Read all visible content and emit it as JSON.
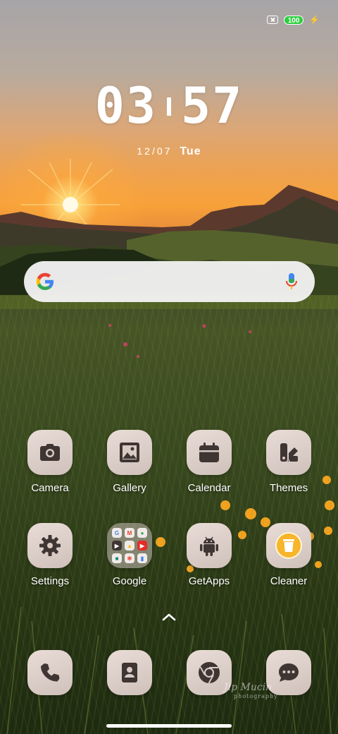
{
  "status_bar": {
    "sim_icon": "no-sim-icon",
    "battery_level": "100",
    "charging_icon": "bolt-icon"
  },
  "clock": {
    "hours": "03",
    "minutes": "57",
    "date": "12/07",
    "weekday": "Tue"
  },
  "search_bar": {
    "left_icon": "google-logo-icon",
    "right_icon": "mic-icon"
  },
  "apps": [
    {
      "label": "Camera",
      "icon": "camera-icon"
    },
    {
      "label": "Gallery",
      "icon": "gallery-icon"
    },
    {
      "label": "Calendar",
      "icon": "calendar-icon"
    },
    {
      "label": "Themes",
      "icon": "themes-icon"
    },
    {
      "label": "Settings",
      "icon": "gear-icon"
    },
    {
      "label": "Google",
      "icon": "folder-icon"
    },
    {
      "label": "GetApps",
      "icon": "android-icon"
    },
    {
      "label": "Cleaner",
      "icon": "trash-icon"
    }
  ],
  "dock": [
    {
      "icon": "phone-icon"
    },
    {
      "icon": "contacts-icon"
    },
    {
      "icon": "chrome-icon"
    },
    {
      "icon": "messages-icon"
    }
  ],
  "watermark": {
    "line1": "Jip Mucin",
    "line2": "photography"
  },
  "colors": {
    "tile": "#d9cac4",
    "icon": "#3f3533",
    "battery": "#2ecc40"
  }
}
